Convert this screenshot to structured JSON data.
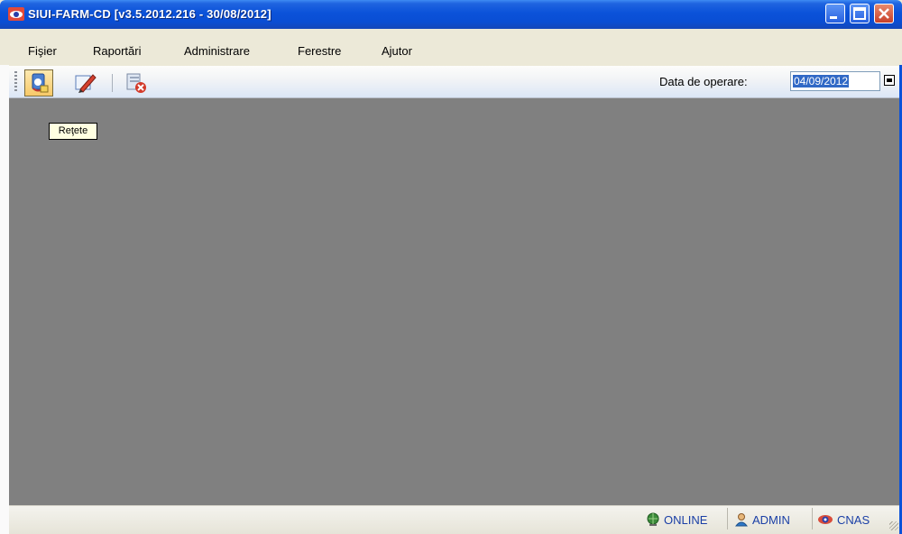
{
  "window": {
    "title": "SIUI-FARM-CD [v3.5.2012.216 - 30/08/2012]",
    "minimize_icon": "minimize-icon",
    "maximize_icon": "maximize-icon",
    "close_icon": "close-icon"
  },
  "menu": {
    "items": [
      {
        "label": "Fişier"
      },
      {
        "label": "Raportări"
      },
      {
        "label": "Administrare"
      },
      {
        "label": "Ferestre"
      },
      {
        "label": "Ajutor"
      }
    ]
  },
  "toolbar": {
    "buttons": [
      {
        "icon": "retete-icon",
        "tooltip": "Reţete",
        "active": true
      },
      {
        "icon": "edit-icon"
      },
      {
        "icon": "delete-document-icon"
      }
    ],
    "date_label": "Data de operare:",
    "date_value": "04/09/2012"
  },
  "tooltip": {
    "text": "Reţete"
  },
  "statusbar": {
    "online": "ONLINE",
    "admin": "ADMIN",
    "cnas": "CNAS"
  },
  "colors": {
    "titlebar": "#0b52d9",
    "workspace": "#808080",
    "status_text": "#1a3fa6"
  }
}
